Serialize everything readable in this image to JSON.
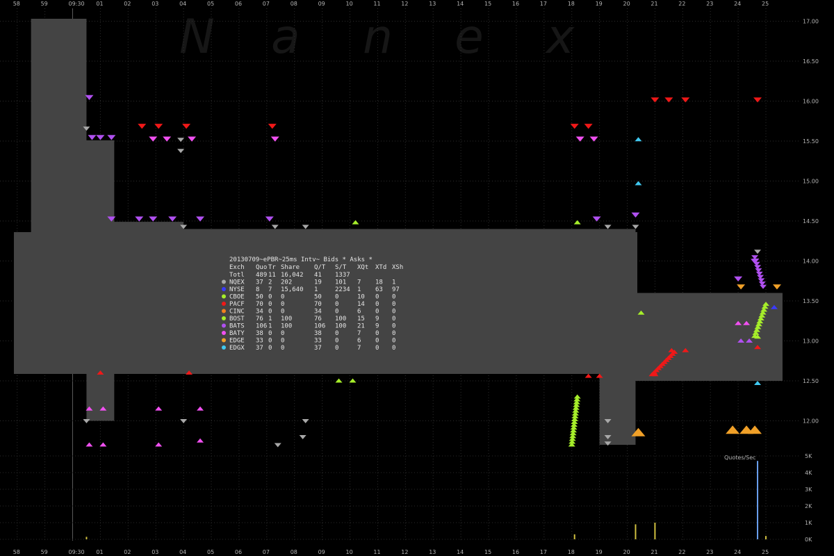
{
  "chart_data": {
    "type": "scatter",
    "watermark": [
      "N",
      "a",
      "n",
      "e",
      "x"
    ],
    "x_ticks": [
      "58",
      "59",
      "09:30",
      "01",
      "02",
      "03",
      "04",
      "05",
      "06",
      "07",
      "08",
      "09",
      "10",
      "11",
      "12",
      "13",
      "14",
      "15",
      "16",
      "17",
      "18",
      "19",
      "20",
      "21",
      "22",
      "23",
      "24",
      "25"
    ],
    "y_ticks": [
      "17.00",
      "16.50",
      "16.00",
      "15.50",
      "15.00",
      "14.50",
      "14.00",
      "13.50",
      "13.00",
      "12.50",
      "12.00"
    ],
    "ylim": [
      11.55,
      17.05
    ],
    "volume_label": "Quotes/Sec",
    "volume_ticks": [
      "5K",
      "4K",
      "3K",
      "2K",
      "1K",
      "0K"
    ],
    "colors": {
      "NQEX": "#a8a8a8",
      "NYSE": "#3a3aff",
      "CBOE": "#a6ee2a",
      "PACF": "#f01818",
      "CINC": "#f08020",
      "BOST": "#a6ee2a",
      "BATS": "#b050f0",
      "BATY": "#f050f0",
      "EDGE": "#f0a028",
      "EDGX": "#40c8f0",
      "bbo_fill": "#444444"
    },
    "stats_box": {
      "title": "20130709~ePBR~25ms Intv~ Bids * Asks *",
      "columns": [
        "Exch",
        "Quo",
        "Tr",
        "Share",
        "Q/T",
        "S/T",
        "XQt",
        "XTd",
        "XSh"
      ],
      "rows": [
        {
          "exch": "Totl",
          "quo": "489",
          "tr": "11",
          "share": "16,042",
          "qt": "41",
          "st": "1337",
          "xqt": "",
          "xtd": "",
          "xsh": "",
          "marker": ""
        },
        {
          "exch": "NQEX",
          "quo": "37",
          "tr": "2",
          "share": "202",
          "qt": "19",
          "st": "101",
          "xqt": "7",
          "xtd": "18",
          "xsh": "1",
          "marker": "NQEX"
        },
        {
          "exch": "NYSE",
          "quo": "8",
          "tr": "7",
          "share": "15,640",
          "qt": "1",
          "st": "2234",
          "xqt": "1",
          "xtd": "63",
          "xsh": "97",
          "marker": "NYSE"
        },
        {
          "exch": "CBOE",
          "quo": "50",
          "tr": "0",
          "share": "0",
          "qt": "50",
          "st": "0",
          "xqt": "10",
          "xtd": "0",
          "xsh": "0",
          "marker": "CBOE"
        },
        {
          "exch": "PACF",
          "quo": "70",
          "tr": "0",
          "share": "0",
          "qt": "70",
          "st": "0",
          "xqt": "14",
          "xtd": "0",
          "xsh": "0",
          "marker": "PACF"
        },
        {
          "exch": "CINC",
          "quo": "34",
          "tr": "0",
          "share": "0",
          "qt": "34",
          "st": "0",
          "xqt": "6",
          "xtd": "0",
          "xsh": "0",
          "marker": "CINC"
        },
        {
          "exch": "BOST",
          "quo": "76",
          "tr": "1",
          "share": "100",
          "qt": "76",
          "st": "100",
          "xqt": "15",
          "xtd": "9",
          "xsh": "0",
          "marker": "BOST"
        },
        {
          "exch": "BATS",
          "quo": "106",
          "tr": "1",
          "share": "100",
          "qt": "106",
          "st": "100",
          "xqt": "21",
          "xtd": "9",
          "xsh": "0",
          "marker": "BATS"
        },
        {
          "exch": "BATY",
          "quo": "38",
          "tr": "0",
          "share": "0",
          "qt": "38",
          "st": "0",
          "xqt": "7",
          "xtd": "0",
          "xsh": "0",
          "marker": "BATY"
        },
        {
          "exch": "EDGE",
          "quo": "33",
          "tr": "0",
          "share": "0",
          "qt": "33",
          "st": "0",
          "xqt": "6",
          "xtd": "0",
          "xsh": "0",
          "marker": "EDGE"
        },
        {
          "exch": "EDGX",
          "quo": "37",
          "tr": "0",
          "share": "0",
          "qt": "37",
          "st": "0",
          "xqt": "7",
          "xtd": "0",
          "xsh": "0",
          "marker": "EDGX"
        }
      ]
    },
    "best_bid_offer": [
      {
        "t": "09:29:58.5",
        "bid": 12.6,
        "ask": 17.03
      },
      {
        "t": "09:30:00.5",
        "bid": 12.0,
        "ask": 15.51
      },
      {
        "t": "09:30:01.5",
        "bid": 12.6,
        "ask": 14.49
      },
      {
        "t": "09:30:04.0",
        "bid": 12.6,
        "ask": 14.4
      },
      {
        "t": "09:30:19.0",
        "bid": 11.7,
        "ask": 14.4
      },
      {
        "t": "09:30:20.3",
        "bid": 12.5,
        "ask": 13.6
      },
      {
        "t": "09:30:25.6",
        "bid": 13.4,
        "ask": 13.55
      }
    ],
    "asks": [
      {
        "exch": "BATS",
        "t": "09:30:00.6",
        "price": 16.05
      },
      {
        "exch": "BATS",
        "t": "09:30:00.7",
        "price": 15.55
      },
      {
        "exch": "BATS",
        "t": "09:30:01.0",
        "price": 15.55
      },
      {
        "exch": "BATS",
        "t": "09:30:01.4",
        "price": 15.55
      },
      {
        "exch": "PACF",
        "t": "09:30:02.5",
        "price": 15.69
      },
      {
        "exch": "PACF",
        "t": "09:30:03.1",
        "price": 15.69
      },
      {
        "exch": "BATY",
        "t": "09:30:02.9",
        "price": 15.53
      },
      {
        "exch": "BATY",
        "t": "09:30:03.4",
        "price": 15.53
      },
      {
        "exch": "PACF",
        "t": "09:30:04.1",
        "price": 15.69
      },
      {
        "exch": "BATY",
        "t": "09:30:04.3",
        "price": 15.53
      },
      {
        "exch": "BATS",
        "t": "09:30:01.4",
        "price": 14.53
      },
      {
        "exch": "BATS",
        "t": "09:30:02.4",
        "price": 14.53
      },
      {
        "exch": "BATS",
        "t": "09:30:02.9",
        "price": 14.53
      },
      {
        "exch": "BATS",
        "t": "09:30:03.6",
        "price": 14.53
      },
      {
        "exch": "BATS",
        "t": "09:30:04.6",
        "price": 14.53
      },
      {
        "exch": "PACF",
        "t": "09:30:07.2",
        "price": 15.69
      },
      {
        "exch": "BATY",
        "t": "09:30:07.3",
        "price": 15.53
      },
      {
        "exch": "BATS",
        "t": "09:30:07.1",
        "price": 14.53
      },
      {
        "exch": "PACF",
        "t": "09:30:18.1",
        "price": 15.69
      },
      {
        "exch": "PACF",
        "t": "09:30:18.6",
        "price": 15.69
      },
      {
        "exch": "BATY",
        "t": "09:30:18.3",
        "price": 15.53
      },
      {
        "exch": "BATY",
        "t": "09:30:18.8",
        "price": 15.53
      },
      {
        "exch": "BATS",
        "t": "09:30:18.9",
        "price": 14.53
      },
      {
        "exch": "PACF",
        "t": "09:30:21.0",
        "price": 16.02
      },
      {
        "exch": "PACF",
        "t": "09:30:21.5",
        "price": 16.02
      },
      {
        "exch": "PACF",
        "t": "09:30:22.1",
        "price": 16.02
      },
      {
        "exch": "PACF",
        "t": "09:30:24.7",
        "price": 16.02
      },
      {
        "exch": "BATS",
        "t": "09:30:20.3",
        "price": 14.58
      },
      {
        "exch": "BATS",
        "t": "09:30:24.0",
        "price": 13.78
      },
      {
        "exch": "BATS",
        "t": "09:30:24.6",
        "price": 14.0
      },
      {
        "exch": "EDGE",
        "t": "09:30:24.1",
        "price": 13.68
      },
      {
        "exch": "EDGE",
        "t": "09:30:25.4",
        "price": 13.68
      }
    ],
    "bids": [
      {
        "exch": "NQEX",
        "t": "09:30:00.5",
        "price": 15.66
      },
      {
        "exch": "NQEX",
        "t": "09:30:03.9",
        "price": 15.52
      },
      {
        "exch": "NQEX",
        "t": "09:30:03.9",
        "price": 15.38
      },
      {
        "exch": "NQEX",
        "t": "09:30:04.0",
        "price": 14.43
      },
      {
        "exch": "NQEX",
        "t": "09:30:07.3",
        "price": 14.43
      },
      {
        "exch": "NQEX",
        "t": "09:30:08.4",
        "price": 14.43
      },
      {
        "exch": "CBOE",
        "t": "09:30:10.2",
        "price": 14.48
      },
      {
        "exch": "CBOE",
        "t": "09:30:18.2",
        "price": 14.48
      },
      {
        "exch": "NQEX",
        "t": "09:30:19.3",
        "price": 14.43
      },
      {
        "exch": "NQEX",
        "t": "09:30:20.3",
        "price": 14.43
      },
      {
        "exch": "EDGX",
        "t": "09:30:20.4",
        "price": 14.97
      },
      {
        "exch": "EDGX",
        "t": "09:30:20.4",
        "price": 15.52
      },
      {
        "exch": "NQEX",
        "t": "09:30:24.7",
        "price": 14.12
      },
      {
        "exch": "NYSE",
        "t": "09:30:25.3",
        "price": 13.42
      },
      {
        "exch": "BOST",
        "t": "09:30:20.5",
        "price": 13.35
      },
      {
        "exch": "PACF",
        "t": "09:30:21.0",
        "price": 12.58
      },
      {
        "exch": "PACF",
        "t": "09:30:21.6",
        "price": 12.88
      },
      {
        "exch": "PACF",
        "t": "09:30:22.1",
        "price": 12.88
      },
      {
        "exch": "PACF",
        "t": "09:30:24.7",
        "price": 12.92
      },
      {
        "exch": "BOST",
        "t": "09:30:24.7",
        "price": 13.05
      },
      {
        "exch": "BOST",
        "t": "09:30:09.6",
        "price": 12.5
      },
      {
        "exch": "BOST",
        "t": "09:30:10.1",
        "price": 12.5
      },
      {
        "exch": "PACF",
        "t": "09:30:01.0",
        "price": 12.6
      },
      {
        "exch": "PACF",
        "t": "09:30:04.2",
        "price": 12.6
      },
      {
        "exch": "BATY",
        "t": "09:30:00.6",
        "price": 12.15
      },
      {
        "exch": "BATY",
        "t": "09:30:01.1",
        "price": 12.15
      },
      {
        "exch": "BATY",
        "t": "09:30:03.1",
        "price": 12.15
      },
      {
        "exch": "BATY",
        "t": "09:30:04.6",
        "price": 12.15
      },
      {
        "exch": "NQEX",
        "t": "09:30:00.5",
        "price": 12.0
      },
      {
        "exch": "NQEX",
        "t": "09:30:04.0",
        "price": 12.0
      },
      {
        "exch": "NQEX",
        "t": "09:30:08.4",
        "price": 12.0
      },
      {
        "exch": "BATY",
        "t": "09:30:00.6",
        "price": 11.7
      },
      {
        "exch": "BATY",
        "t": "09:30:01.1",
        "price": 11.7
      },
      {
        "exch": "BATY",
        "t": "09:30:03.1",
        "price": 11.7
      },
      {
        "exch": "BATY",
        "t": "09:30:04.6",
        "price": 11.75
      },
      {
        "exch": "NQEX",
        "t": "09:30:07.4",
        "price": 11.7
      },
      {
        "exch": "NQEX",
        "t": "09:30:08.3",
        "price": 11.8
      },
      {
        "exch": "NQEX",
        "t": "09:30:19.3",
        "price": 12.0
      },
      {
        "exch": "NQEX",
        "t": "09:30:19.3",
        "price": 11.8
      },
      {
        "exch": "NQEX",
        "t": "09:30:19.3",
        "price": 11.72
      },
      {
        "exch": "EDGE",
        "t": "09:30:20.4",
        "price": 11.85
      },
      {
        "exch": "EDGE",
        "t": "09:30:23.8",
        "price": 11.88
      },
      {
        "exch": "EDGE",
        "t": "09:30:24.3",
        "price": 11.88
      },
      {
        "exch": "EDGE",
        "t": "09:30:24.6",
        "price": 11.88
      },
      {
        "exch": "EDGX",
        "t": "09:30:24.7",
        "price": 12.47
      },
      {
        "exch": "PACF",
        "t": "09:30:18.6",
        "price": 12.56
      },
      {
        "exch": "PACF",
        "t": "09:30:19.0",
        "price": 12.56
      },
      {
        "exch": "BATY",
        "t": "09:30:24.0",
        "price": 13.22
      },
      {
        "exch": "BATY",
        "t": "09:30:24.3",
        "price": 13.22
      },
      {
        "exch": "BATS",
        "t": "09:30:24.1",
        "price": 13.0
      },
      {
        "exch": "BATS",
        "t": "09:30:24.4",
        "price": 13.0
      }
    ],
    "bid_runs": [
      {
        "exch": "BOST",
        "from": {
          "t": "09:30:18.0",
          "price": 11.7
        },
        "to": {
          "t": "09:30:18.2",
          "price": 12.3
        },
        "count": 18
      },
      {
        "exch": "PACF",
        "from": {
          "t": "09:30:20.9",
          "price": 12.58
        },
        "to": {
          "t": "09:30:21.7",
          "price": 12.86
        },
        "count": 12
      },
      {
        "exch": "BOST",
        "from": {
          "t": "09:30:24.6",
          "price": 13.06
        },
        "to": {
          "t": "09:30:25.0",
          "price": 13.46
        },
        "count": 12
      }
    ],
    "ask_runs": [
      {
        "exch": "BATS",
        "from": {
          "t": "09:30:24.6",
          "price": 14.05
        },
        "to": {
          "t": "09:30:24.9",
          "price": 13.68
        },
        "count": 10
      }
    ],
    "volume": [
      {
        "t": "09:30:00.5",
        "qps": 150
      },
      {
        "t": "09:30:18.1",
        "qps": 300
      },
      {
        "t": "09:30:20.3",
        "qps": 900
      },
      {
        "t": "09:30:21.0",
        "qps": 1000
      },
      {
        "t": "09:30:24.7",
        "qps": 4700
      },
      {
        "t": "09:30:25.0",
        "qps": 200
      }
    ]
  }
}
